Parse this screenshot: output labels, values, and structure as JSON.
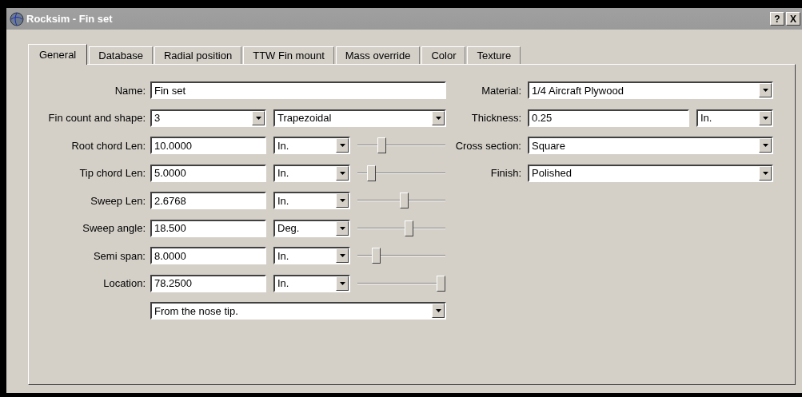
{
  "window": {
    "title": "Rocksim - Fin set",
    "help_button": "?",
    "close_button": "X"
  },
  "tabs": [
    {
      "label": "General",
      "selected": true
    },
    {
      "label": "Database",
      "selected": false
    },
    {
      "label": "Radial position",
      "selected": false
    },
    {
      "label": "TTW Fin mount",
      "selected": false
    },
    {
      "label": "Mass override",
      "selected": false
    },
    {
      "label": "Color",
      "selected": false
    },
    {
      "label": "Texture",
      "selected": false
    }
  ],
  "left_fields": [
    {
      "kind": "text",
      "label": "Name:",
      "value": "Fin set"
    },
    {
      "kind": "count_shape",
      "label": "Fin count and shape:",
      "count": "3",
      "shape": "Trapezoidal"
    },
    {
      "kind": "length",
      "label": "Root chord Len:",
      "value": "10.0000",
      "unit": "In.",
      "level": 0.25
    },
    {
      "kind": "length",
      "label": "Tip chord Len:",
      "value": "5.0000",
      "unit": "In.",
      "level": 0.12
    },
    {
      "kind": "length",
      "label": "Sweep Len:",
      "value": "2.6768",
      "unit": "In.",
      "level": 0.54
    },
    {
      "kind": "length",
      "label": "Sweep angle:",
      "value": "18.500",
      "unit": "Deg.",
      "level": 0.6
    },
    {
      "kind": "length",
      "label": "Semi span:",
      "value": "8.0000",
      "unit": "In.",
      "level": 0.18
    },
    {
      "kind": "length",
      "label": "Location:",
      "value": "78.2500",
      "unit": "In.",
      "level": 1
    },
    {
      "kind": "select",
      "value": "From the nose tip."
    }
  ],
  "right_fields": [
    {
      "kind": "select",
      "label": "Material:",
      "value": "1/4 Aircraft Plywood"
    },
    {
      "kind": "thickness",
      "label": "Thickness:",
      "value": "0.25",
      "unit": "In."
    },
    {
      "kind": "select",
      "label": "Cross section:",
      "value": "Square"
    },
    {
      "kind": "select",
      "label": "Finish:",
      "value": "Polished"
    }
  ]
}
